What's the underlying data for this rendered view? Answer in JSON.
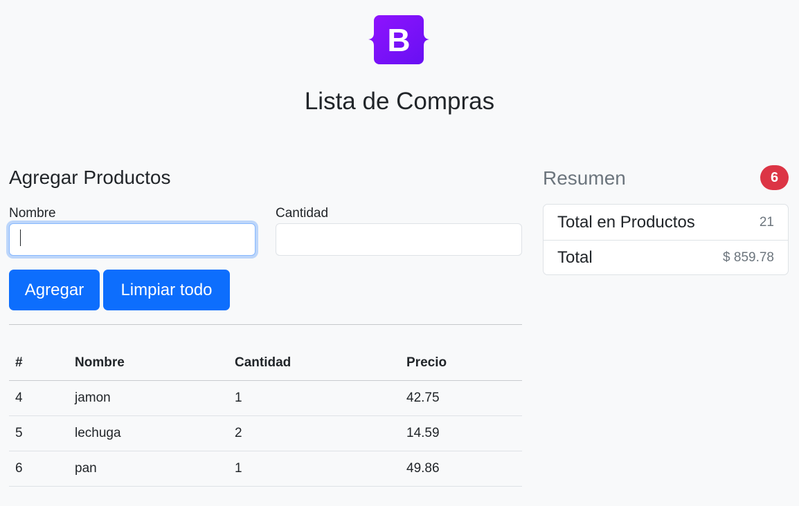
{
  "header": {
    "logo_letter": "B",
    "title": "Lista de Compras"
  },
  "form": {
    "section_title": "Agregar Productos",
    "name_label": "Nombre",
    "name_value": "",
    "quantity_label": "Cantidad",
    "quantity_value": "",
    "add_button": "Agregar",
    "clear_button": "Limpiar todo"
  },
  "table": {
    "headers": [
      "#",
      "Nombre",
      "Cantidad",
      "Precio"
    ],
    "rows": [
      {
        "id": "4",
        "name": "jamon",
        "qty": "1",
        "price": "42.75"
      },
      {
        "id": "5",
        "name": "lechuga",
        "qty": "2",
        "price": "14.59"
      },
      {
        "id": "6",
        "name": "pan",
        "qty": "1",
        "price": "49.86"
      }
    ]
  },
  "summary": {
    "title": "Resumen",
    "badge": "6",
    "items": [
      {
        "label": "Total en Productos",
        "value": "21"
      },
      {
        "label": "Total",
        "value": "$ 859.78"
      }
    ]
  },
  "colors": {
    "primary": "#0d6efd",
    "danger": "#dc3545",
    "brand": "#7c1ff2"
  }
}
